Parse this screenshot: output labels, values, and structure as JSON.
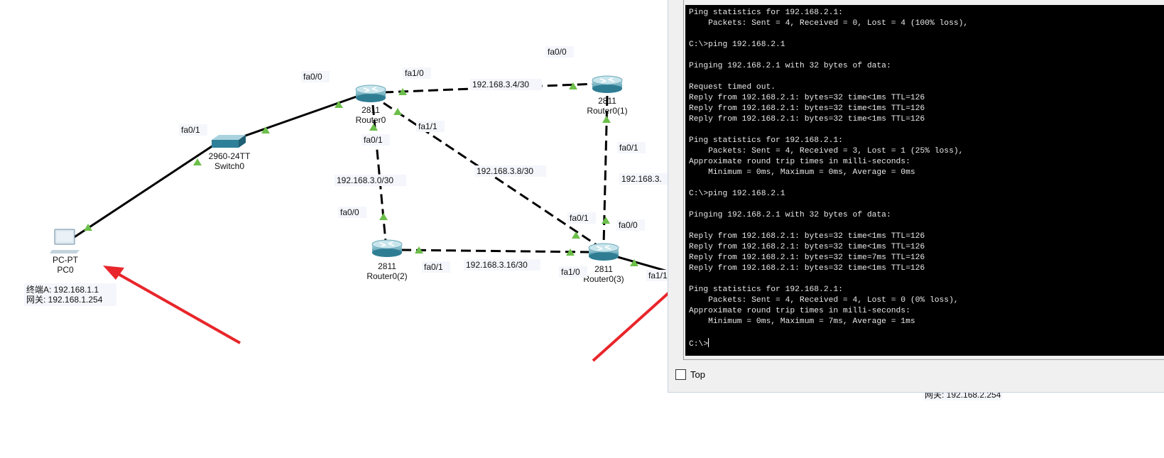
{
  "topology": {
    "devices": [
      {
        "id": "pc0",
        "model": "PC-PT",
        "name": "PC0"
      },
      {
        "id": "switch0",
        "model": "2960-24TT",
        "name": "Switch0"
      },
      {
        "id": "router0",
        "model": "2811",
        "name": "Router0"
      },
      {
        "id": "router1",
        "model": "2811",
        "name": "Router0(1)"
      },
      {
        "id": "router2",
        "model": "2811",
        "name": "Router0(2)"
      },
      {
        "id": "router3",
        "model": "2811",
        "name": "Router0(3)"
      }
    ],
    "port_labels": {
      "sw_fa01": "fa0/1",
      "r0_fa00": "fa0/0",
      "r0_fa10": "fa1/0",
      "r1_fa00": "fa0/0",
      "r0_fa11": "fa1/1",
      "r0_fa01": "fa0/1",
      "r2_fa00": "fa0/0",
      "r2_fa01": "fa0/1",
      "r1_fa01": "fa0/1",
      "r3_fa01": "fa0/1",
      "r3_fa00": "fa0/0",
      "r3_fa10": "fa1/0",
      "r3_fa11": "fa1/1"
    },
    "networks": {
      "n34": "192.168.3.4/30",
      "n30": "192.168.3.0/30",
      "n38": "192.168.3.8/30",
      "n316": "192.168.3.16/30",
      "n3x": "192.168.3."
    },
    "pc_note": {
      "line1": "终端A:  192.168.1.1",
      "line2": "网关:  192.168.1.254"
    },
    "link_up_color": "#6cbf4a",
    "annotation_arrow_color": "#e8262b"
  },
  "terminal": {
    "lines": [
      "Ping statistics for 192.168.2.1:",
      "    Packets: Sent = 4, Received = 0, Lost = 4 (100% loss),",
      "",
      "C:\\>ping 192.168.2.1",
      "",
      "Pinging 192.168.2.1 with 32 bytes of data:",
      "",
      "Request timed out.",
      "Reply from 192.168.2.1: bytes=32 time<1ms TTL=126",
      "Reply from 192.168.2.1: bytes=32 time<1ms TTL=126",
      "Reply from 192.168.2.1: bytes=32 time<1ms TTL=126",
      "",
      "Ping statistics for 192.168.2.1:",
      "    Packets: Sent = 4, Received = 3, Lost = 1 (25% loss),",
      "Approximate round trip times in milli-seconds:",
      "    Minimum = 0ms, Maximum = 0ms, Average = 0ms",
      "",
      "C:\\>ping 192.168.2.1",
      "",
      "Pinging 192.168.2.1 with 32 bytes of data:",
      "",
      "Reply from 192.168.2.1: bytes=32 time<1ms TTL=126",
      "Reply from 192.168.2.1: bytes=32 time<1ms TTL=126",
      "Reply from 192.168.2.1: bytes=32 time=7ms TTL=126",
      "Reply from 192.168.2.1: bytes=32 time<1ms TTL=126",
      "",
      "Ping statistics for 192.168.2.1:",
      "    Packets: Sent = 4, Received = 4, Lost = 0 (0% loss),",
      "Approximate round trip times in milli-seconds:",
      "    Minimum = 0ms, Maximum = 7ms, Average = 1ms",
      "",
      "C:\\>"
    ],
    "top_checkbox_label": "Top",
    "top_checked": false
  },
  "behind_window_note": "网关:  192.168.2.254"
}
